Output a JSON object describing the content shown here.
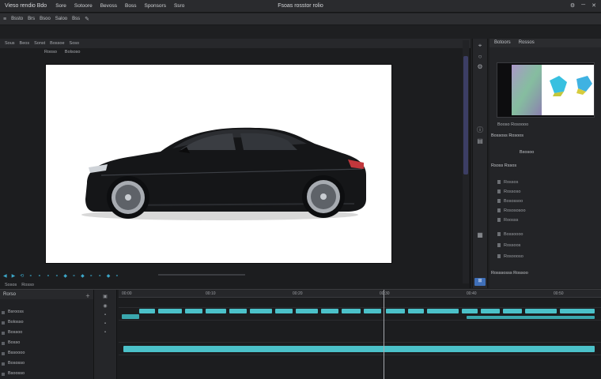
{
  "app": {
    "brand": "Vieso rendio Bdo",
    "window_title": "Fsoas rosstor rolio",
    "window_controls": [
      "⚙",
      "─",
      "✕"
    ]
  },
  "menu": [
    "Sore",
    "Sotoore",
    "Bevoss",
    "Boss",
    "Sponsors",
    "Ssro"
  ],
  "toolbar": [
    "Bssto",
    "Brs",
    "Bsoo",
    "Saloo",
    "Bss"
  ],
  "viewer": {
    "tabs": [
      "Sous",
      "Beos",
      "Sonst",
      "Bossoe",
      "Soso"
    ],
    "sub_labels": [
      "Rooso",
      "Bolsoso"
    ],
    "controls": [
      "◀",
      "▶",
      "⟲",
      "⚬",
      "⚬",
      "⚬",
      "⚬",
      "◆",
      "⚬",
      "◆",
      "⚬",
      "⚬",
      "◆",
      "⚬"
    ],
    "status": [
      "Sosos",
      "Rosso"
    ]
  },
  "right_panel": {
    "header": [
      "Botoors",
      "Rossos"
    ],
    "thumb_label": "Booso Rosoooo",
    "section1": "Bossoss Rosoos",
    "section2": "Bxosoo",
    "section3": "Rsoss Rssos",
    "rows": [
      "Rossos",
      "Rossoso",
      "Bosossoo",
      "Rosososoo",
      "Roosss",
      "Bossoooo",
      "Rossoos",
      "Rosoooso"
    ],
    "footer": "Rosssosss Rossoo",
    "badge": "⊞"
  },
  "timeline": {
    "header_left": "Rorso",
    "tracks": [
      "Bsrooss",
      "Bolosso",
      "Bossoo",
      "Bosso",
      "Bssoooo",
      "Bososso",
      "Bsoosso"
    ],
    "ruler": [
      "00:00",
      "00:10",
      "00:20",
      "00:30",
      "00:40",
      "00:50"
    ]
  },
  "colors": {
    "accent": "#4bc1c9",
    "panel": "#1e1f21",
    "highlight": "#3f6fb8"
  }
}
